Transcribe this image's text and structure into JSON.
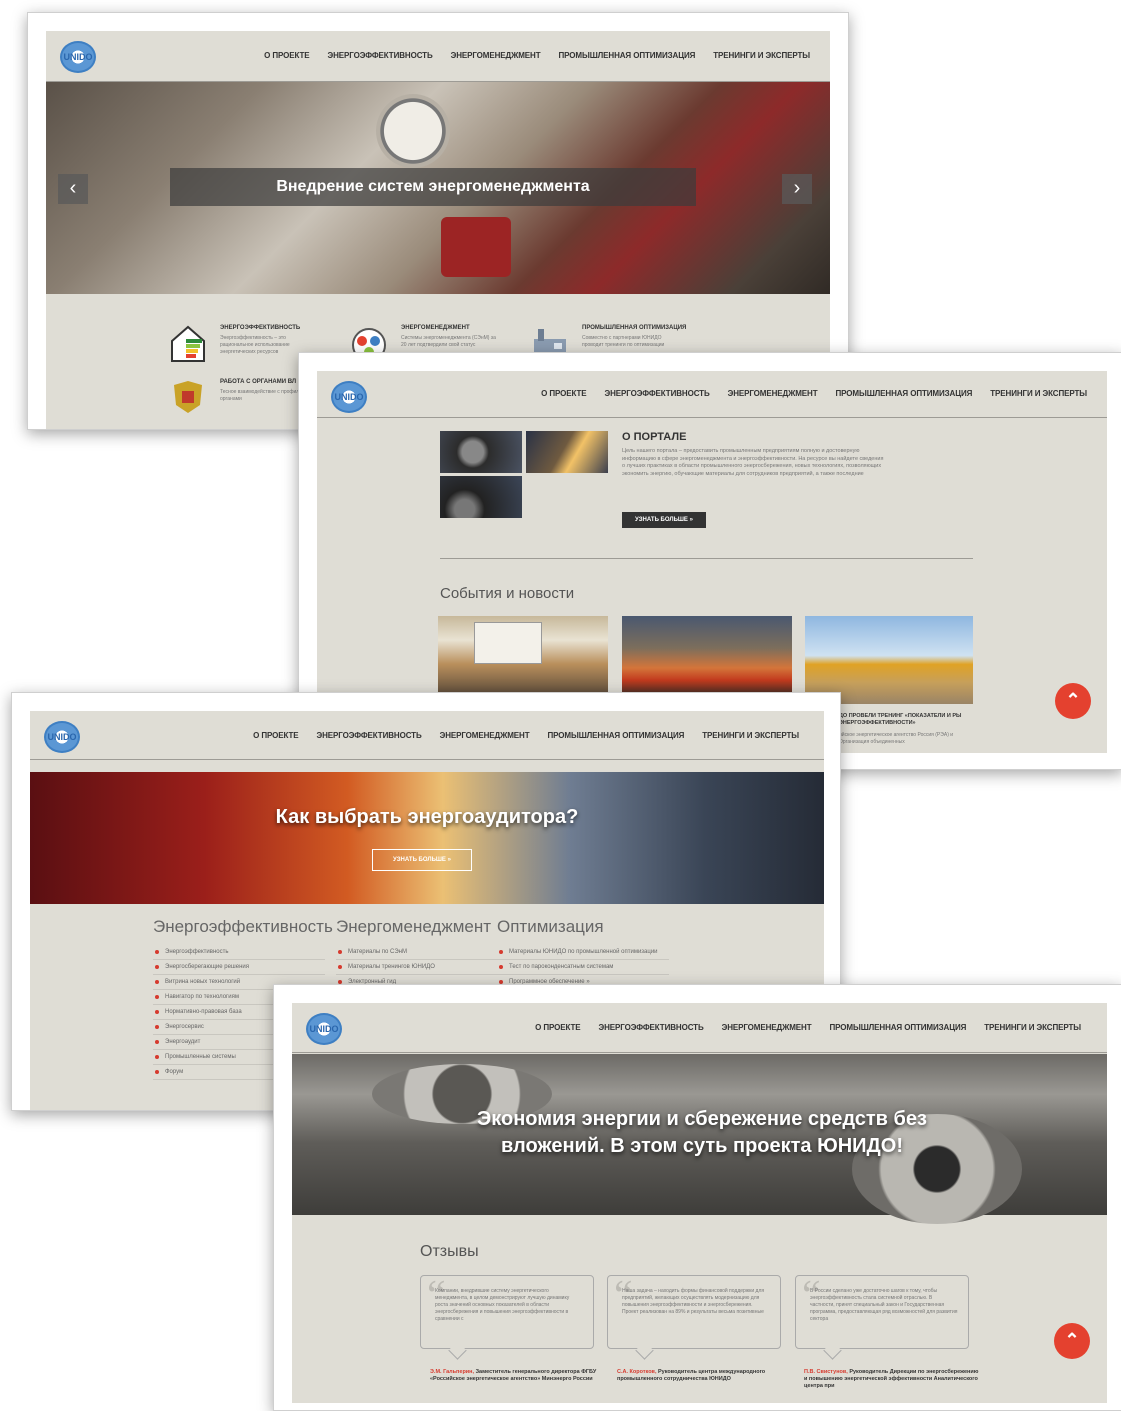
{
  "logo_text": "UNIDO",
  "menu": [
    "О ПРОЕКТЕ",
    "ЭНЕРГОЭФФЕКТИВНОСТЬ",
    "ЭНЕРГОМЕНЕДЖМЕНТ",
    "ПРОМЫШЛЕННАЯ ОПТИМИЗАЦИЯ",
    "ТРЕНИНГИ И ЭКСПЕРТЫ"
  ],
  "screen1": {
    "slide_title": "Внедрение систем энергоменеджмента",
    "prev_icon": "chevron-left-icon",
    "next_icon": "chevron-right-icon",
    "features": [
      {
        "title": "ЭНЕРГОЭФФЕКТИВНОСТЬ",
        "text": "Энергоэффективность – это рациональное использование энергетических ресурсов"
      },
      {
        "title": "ЭНЕРГОМЕНЕДЖМЕНТ",
        "text": "Системы энергоменеджмента (СЭнМ) за 20 лет подтвердили свой статус"
      },
      {
        "title": "ПРОМЫШЛЕННАЯ ОПТИМИЗАЦИЯ",
        "text": "Совместно с партнерами ЮНИДО проводит тренинги по оптимизации"
      },
      {
        "title": "РАБОТА С ОРГАНАМИ ВЛ",
        "text": "Тесное взаимодействие с профильными органами"
      }
    ]
  },
  "screen2": {
    "about_title": "О ПОРТАЛЕ",
    "about_text": "Цель нашего портала – предоставить промышленным предприятиям полную и достоверную информацию в сфере энергоменеджмента и энергоэффективности. На ресурсе вы найдете сведения о лучших практиках в области промышленного энергосбережения, новых технологиях, позволяющих экономить энергию, обучающие материалы для сотрудников предприятий, а также последние",
    "more_button": "УЗНАТЬ БОЛЬШЕ »",
    "news_title": "События и новости",
    "news_caption": "ДО ПРОВЕЛИ ТРЕНИНГ «ПОКАЗАТЕЛИ И РЫ ЭНЕРГОЭФФЕКТИВНОСТИ»",
    "news_text": "ийское энергетическое агентство Россия (РЭА) и Организация объединенных"
  },
  "screen3": {
    "hero_title": "Как выбрать энергоаудитора?",
    "hero_button": "УЗНАТЬ БОЛЬШЕ »",
    "columns": [
      {
        "heading": "Энергоэффективность",
        "items": [
          "Энергоэффективность",
          "Энергосберегающие решения",
          "Витрина новых технологий",
          "Навигатор по технологиям",
          "Нормативно-правовая база",
          "Энергосервис",
          "Энергоаудит",
          "Промышленные системы",
          "Форум"
        ]
      },
      {
        "heading": "Энергоменеджмент",
        "items": [
          "Материалы по СЭнМ",
          "Материалы тренингов ЮНИДО",
          "Электронный гид"
        ]
      },
      {
        "heading": "Оптимизация",
        "items": [
          "Материалы ЮНИДО по промышленной оптимизации",
          "Тест по пароконденсатным системам",
          "Программное обеспечение »"
        ]
      }
    ]
  },
  "screen4": {
    "hero_title": "Экономия энергии и сбережение средств без вложений. В этом суть проекта ЮНИДО!",
    "reviews_title": "Отзывы",
    "reviews": [
      {
        "text": "Компании, внедрившие систему энергетического менеджмента, в целом демонстрируют лучшую динамику роста значений основных показателей в области энергосбережения и повышения энергоэффективности в сравнении с",
        "name": "Э.М. Гальперин,",
        "role": "Заместитель генерального директора ФГБУ «Российское энергетическое агентство» Минэнерго России"
      },
      {
        "text": "Наша задача – находить формы финансовой поддержки для предприятий, желающих осуществлять модернизацию для повышения энергоэффективности и энергосбережения. Проект реализован на 89% и результаты весьма позитивные",
        "name": "С.А. Коротков,",
        "role": "Руководитель центра международного промышленного сотрудничества ЮНИДО"
      },
      {
        "text": "В России сделано уже достаточно шагов к тому, чтобы энергоэффективность стала системной отраслью. В частности, принят специальный закон и Государственная программа, предоставляющая ряд возможностей для развития сектора",
        "name": "П.В. Свистунов,",
        "role": "Руководитель Дирекции по энергосбережению и повышению энергетической эффективности Аналитического центра при"
      }
    ]
  },
  "scroll_top_icon": "chevron-up-icon"
}
